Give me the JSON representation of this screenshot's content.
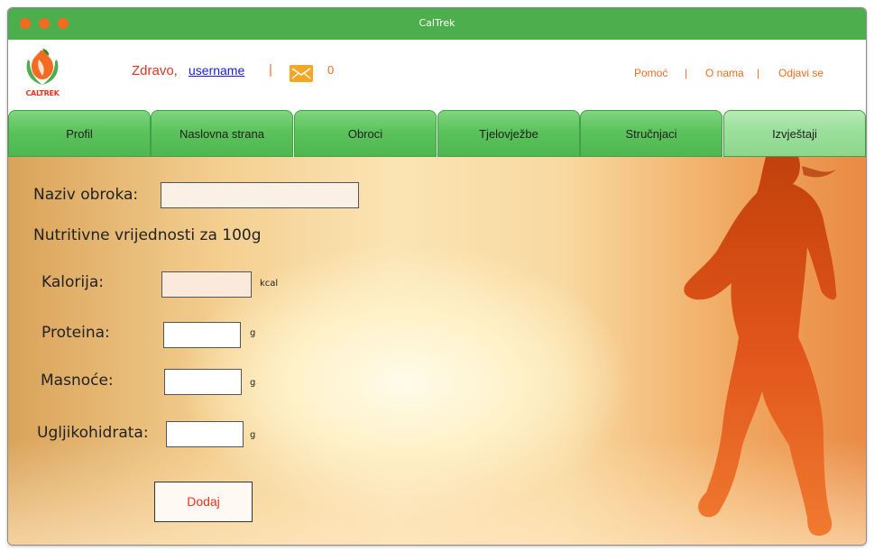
{
  "window": {
    "title": "CalTrek"
  },
  "logo": {
    "text": "CALTREK"
  },
  "header": {
    "greeting": "Zdravo,",
    "username": "username",
    "separator": "|",
    "message_count": "0",
    "links": {
      "help": "Pomoć",
      "about": "O nama",
      "logout": "Odjavi se",
      "divider": "|"
    }
  },
  "tabs": [
    "Profil",
    "Naslovna strana",
    "Obroci",
    "Tjelovježbe",
    "Stručnjaci",
    "Izvještaji"
  ],
  "active_tab": "Izvještaji",
  "form": {
    "meal_name_label": "Naziv obroka:",
    "meal_name_value": "",
    "nutrition_heading": "Nutritivne vrijednosti za 100g",
    "calories_label": "Kalorija:",
    "calories_unit": "kcal",
    "protein_label": "Proteina:",
    "protein_unit": "g",
    "fat_label": "Masnoće:",
    "fat_unit": "g",
    "carbs_label": "Ugljikohidrata:",
    "carbs_unit": "g",
    "submit_label": "Dodaj"
  },
  "colors": {
    "titlebar": "#4cae4c",
    "accent_orange": "#f36b21",
    "accent_red": "#e5331f",
    "tab_green": "#5cc35c",
    "mail_icon": "#f6a623"
  },
  "icons": [
    "window-close-dot",
    "window-minimize-dot",
    "window-maximize-dot",
    "caltrek-logo",
    "mail-icon"
  ]
}
